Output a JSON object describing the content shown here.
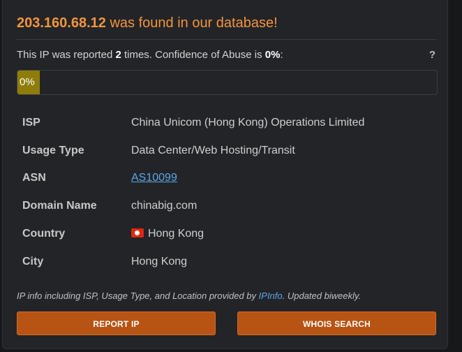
{
  "header": {
    "ip": "203.160.68.12",
    "suffix": " was found in our database!"
  },
  "summary": {
    "prefix": "This IP was reported ",
    "count": "2",
    "middle": " times. Confidence of Abuse is ",
    "confidence": "0%",
    "end": ":",
    "help_icon": "?"
  },
  "progress": {
    "label": "0%",
    "value_percent": 0
  },
  "details": {
    "isp_label": "ISP",
    "isp_value": "China Unicom (Hong Kong) Operations Limited",
    "usage_label": "Usage Type",
    "usage_value": "Data Center/Web Hosting/Transit",
    "asn_label": "ASN",
    "asn_value": "AS10099",
    "domain_label": "Domain Name",
    "domain_value": "chinabig.com",
    "country_label": "Country",
    "country_value": "Hong Kong",
    "country_flag_icon": "hong-kong-flag-icon",
    "city_label": "City",
    "city_value": "Hong Kong"
  },
  "footnote": {
    "prefix": "IP info including ISP, Usage Type, and Location provided by ",
    "link": "IPInfo",
    "suffix": ". Updated biweekly."
  },
  "buttons": {
    "report": "REPORT IP",
    "whois": "WHOIS SEARCH"
  },
  "colors": {
    "accent": "#f3953d",
    "button": "#b75414",
    "progress_fill": "#8f7d09",
    "link": "#5aa8e8"
  }
}
